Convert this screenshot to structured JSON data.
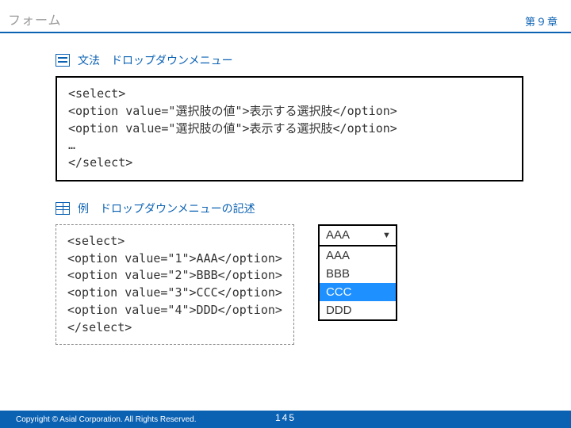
{
  "header": {
    "title": "フォーム",
    "chapter": "第９章"
  },
  "section1": {
    "label": "文法　ドロップダウンメニュー",
    "code": "<select>\n<option value=\"選択肢の値\">表示する選択肢</option>\n<option value=\"選択肢の値\">表示する選択肢</option>\n…\n</select>"
  },
  "section2": {
    "label": "例　ドロップダウンメニューの記述",
    "code": "<select>\n<option value=\"1\">AAA</option>\n<option value=\"2\">BBB</option>\n<option value=\"3\">CCC</option>\n<option value=\"4\">DDD</option>\n</select>"
  },
  "demo": {
    "selected": "AAA",
    "options": [
      "AAA",
      "BBB",
      "CCC",
      "DDD"
    ],
    "highlightIndex": 2
  },
  "footer": {
    "copyright": "Copyright © Asial Corporation. All Rights Reserved.",
    "page": "145"
  }
}
